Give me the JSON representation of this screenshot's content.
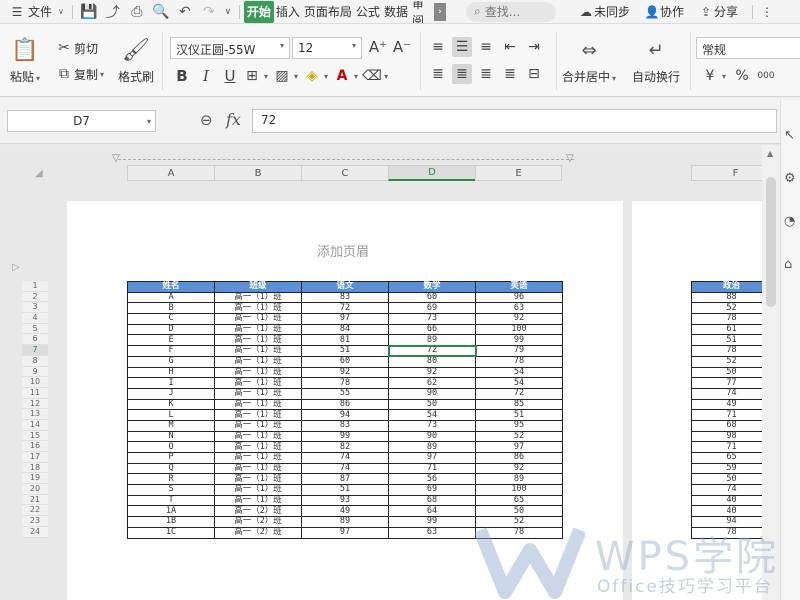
{
  "menubar": {
    "file_label": "文件",
    "tabs": [
      "开始",
      "插入",
      "页面布局",
      "公式",
      "数据",
      "审阅"
    ],
    "search_label": "查找...",
    "unsynced_label": "未同步",
    "collab_label": "协作",
    "share_label": "分享",
    "more_label": "⋮"
  },
  "ribbon": {
    "paste_label": "粘贴",
    "cut_label": "剪切",
    "copy_label": "复制",
    "format_painter_label": "格式刷",
    "font_name": "汉仪正圆-55W",
    "font_size": "12",
    "bold": "B",
    "italic": "I",
    "underline": "U",
    "merge_center_label": "合并居中",
    "wrap_text_label": "自动换行",
    "number_format": "常规",
    "currency": "¥",
    "percent": "%",
    "thousands": "000"
  },
  "formula_bar": {
    "cell_ref": "D7",
    "fx_label": "fx",
    "value": "72"
  },
  "sheet": {
    "header_hint": "添加页眉",
    "columns": [
      "A",
      "B",
      "C",
      "D",
      "E"
    ],
    "col_f": "F",
    "active_col": "D",
    "active_row": 7,
    "headers": [
      "姓名",
      "班级",
      "语文",
      "数学",
      "英语"
    ],
    "header_f": "政治",
    "rows": [
      [
        "A",
        "高一（1）班",
        "83",
        "60",
        "96"
      ],
      [
        "B",
        "高一（1）班",
        "72",
        "69",
        "63"
      ],
      [
        "C",
        "高一（1）班",
        "97",
        "73",
        "92"
      ],
      [
        "D",
        "高一（1）班",
        "84",
        "66",
        "100"
      ],
      [
        "E",
        "高一（1）班",
        "81",
        "89",
        "99"
      ],
      [
        "F",
        "高一（1）班",
        "51",
        "72",
        "79"
      ],
      [
        "G",
        "高一（1）班",
        "60",
        "80",
        "78"
      ],
      [
        "H",
        "高一（1）班",
        "92",
        "92",
        "54"
      ],
      [
        "I",
        "高一（1）班",
        "78",
        "62",
        "54"
      ],
      [
        "J",
        "高一（1）班",
        "55",
        "90",
        "72"
      ],
      [
        "K",
        "高一（1）班",
        "86",
        "50",
        "85"
      ],
      [
        "L",
        "高一（1）班",
        "94",
        "54",
        "51"
      ],
      [
        "M",
        "高一（1）班",
        "83",
        "73",
        "95"
      ],
      [
        "N",
        "高一（1）班",
        "99",
        "90",
        "52"
      ],
      [
        "O",
        "高一（1）班",
        "82",
        "89",
        "97"
      ],
      [
        "P",
        "高一（1）班",
        "74",
        "97",
        "86"
      ],
      [
        "Q",
        "高一（1）班",
        "74",
        "71",
        "92"
      ],
      [
        "R",
        "高一（1）班",
        "87",
        "56",
        "89"
      ],
      [
        "S",
        "高一（1）班",
        "51",
        "69",
        "100"
      ],
      [
        "T",
        "高一（1）班",
        "93",
        "68",
        "65"
      ],
      [
        "1A",
        "高一（2）班",
        "49",
        "64",
        "50"
      ],
      [
        "1B",
        "高一（2）班",
        "89",
        "99",
        "52"
      ],
      [
        "1C",
        "高一（2）班",
        "97",
        "63",
        "78"
      ]
    ],
    "col_f_values": [
      "88",
      "52",
      "78",
      "61",
      "51",
      "78",
      "52",
      "50",
      "77",
      "74",
      "49",
      "71",
      "68",
      "98",
      "71",
      "65",
      "59",
      "50",
      "74",
      "40",
      "40",
      "94",
      "78"
    ]
  },
  "watermark": {
    "title": "WPS学院",
    "subtitle": "Office技巧学习平台"
  }
}
